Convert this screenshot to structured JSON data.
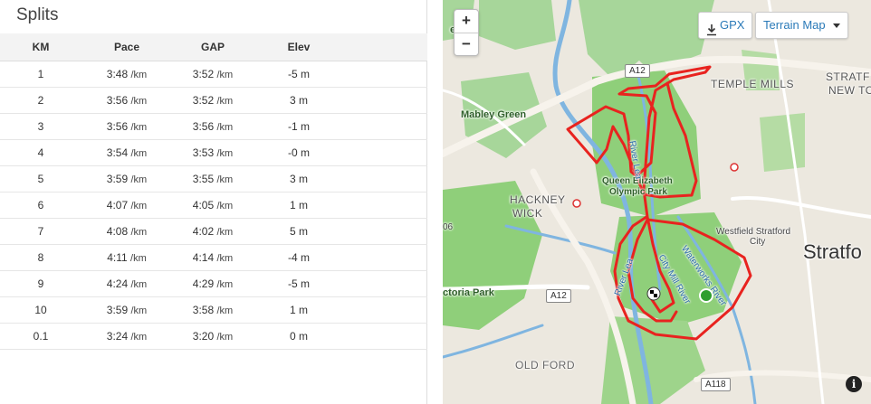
{
  "splits": {
    "title": "Splits",
    "columns": [
      "KM",
      "Pace",
      "GAP",
      "Elev"
    ],
    "unit": "/km",
    "rows": [
      {
        "km": "1",
        "pace": "3:48",
        "gap": "3:52",
        "elev": "-5 m"
      },
      {
        "km": "2",
        "pace": "3:56",
        "gap": "3:52",
        "elev": "3 m"
      },
      {
        "km": "3",
        "pace": "3:56",
        "gap": "3:56",
        "elev": "-1 m"
      },
      {
        "km": "4",
        "pace": "3:54",
        "gap": "3:53",
        "elev": "-0 m"
      },
      {
        "km": "5",
        "pace": "3:59",
        "gap": "3:55",
        "elev": "3 m"
      },
      {
        "km": "6",
        "pace": "4:07",
        "gap": "4:05",
        "elev": "1 m"
      },
      {
        "km": "7",
        "pace": "4:08",
        "gap": "4:02",
        "elev": "5 m"
      },
      {
        "km": "8",
        "pace": "4:11",
        "gap": "4:14",
        "elev": "-4 m"
      },
      {
        "km": "9",
        "pace": "4:24",
        "gap": "4:29",
        "elev": "-5 m"
      },
      {
        "km": "10",
        "pace": "3:59",
        "gap": "3:58",
        "elev": "1 m"
      },
      {
        "km": "0.1",
        "pace": "3:24",
        "gap": "3:20",
        "elev": "0 m"
      }
    ]
  },
  "map": {
    "zoom_in_label": "+",
    "zoom_out_label": "−",
    "gpx_label": "GPX",
    "terrain_label": "Terrain Map",
    "info_label": "i",
    "labels": {
      "temple_mills": "TEMPLE MILLS",
      "stratford_new_1": "STRATF",
      "stratford_new_2": "NEW TO",
      "mabley_green": "Mabley Green",
      "qe_park_1": "Queen Elizabeth",
      "qe_park_2": "Olympic Park",
      "hackney_wick_1": "HACKNEY",
      "hackney_wick_2": "WICK",
      "westfield_1": "Westfield Stratford",
      "westfield_2": "City",
      "stratford": "Stratfo",
      "victoria_park": "ctoria Park",
      "old_ford": "OLD FORD",
      "fields": "elds",
      "river_lea": "River Lea",
      "city_mill_river": "City Mill River",
      "waterworks_river": "Waterworks River",
      "a12_top": "A12",
      "a12_bottom": "A12",
      "a118": "A118",
      "six": "06"
    },
    "colors": {
      "route": "#e8231f",
      "start": "#2e9e2e",
      "park": "#8fcf7a",
      "water": "#7fb5e0",
      "link": "#2a7ab8"
    },
    "icons": [
      "download-icon",
      "caret-down-icon",
      "finish-flag-icon",
      "start-marker-icon",
      "info-icon"
    ]
  }
}
